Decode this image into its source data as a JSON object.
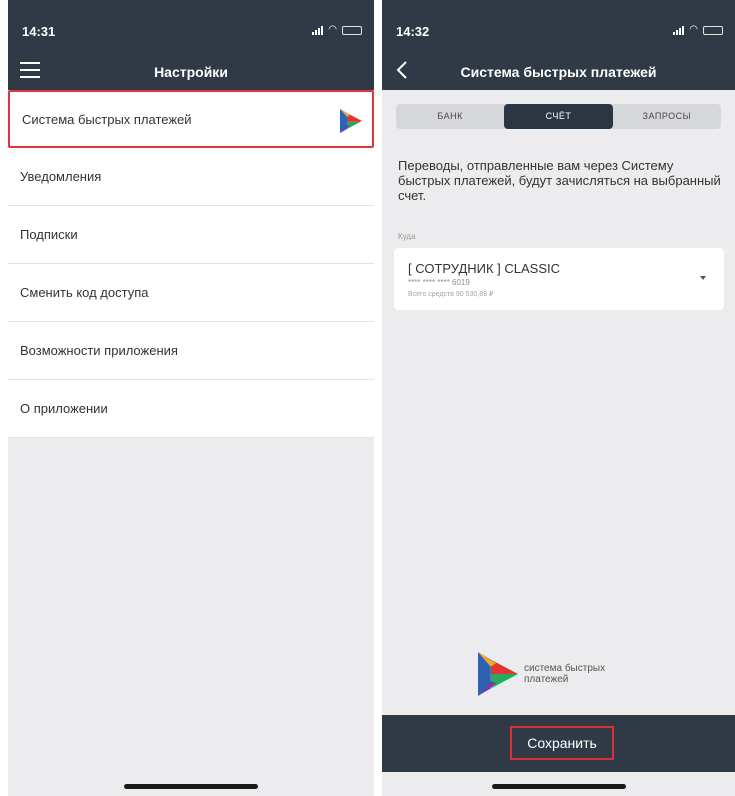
{
  "left_screen": {
    "status": {
      "time": "14:31"
    },
    "header": {
      "title": "Настройки"
    },
    "menu_items": [
      {
        "label": "Система быстрых платежей",
        "highlighted": true
      },
      {
        "label": "Уведомления"
      },
      {
        "label": "Подписки"
      },
      {
        "label": "Сменить код доступа"
      },
      {
        "label": "Возможности приложения"
      },
      {
        "label": "О приложении"
      }
    ]
  },
  "right_screen": {
    "status": {
      "time": "14:32"
    },
    "header": {
      "title": "Система быстрых платежей"
    },
    "tabs": [
      {
        "label": "БАНК",
        "active": false
      },
      {
        "label": "СЧЁТ",
        "active": true
      },
      {
        "label": "ЗАПРОСЫ",
        "active": false
      }
    ],
    "description": "Переводы, отправленные вам через Систему быстрых платежей, будут зачисляться на выбранный счет.",
    "field_label": "Куда",
    "account": {
      "name": "[ СОТРУДНИК ] CLASSIC",
      "number": "**** **** **** 6019",
      "balance": "Всего средств 90 530,89 ₽"
    },
    "brand_text": "система быстрых платежей",
    "save_label": "Сохранить"
  },
  "colors": {
    "header_bg": "#303a46",
    "highlight_border": "#e0343f",
    "screen_bg": "#ececee",
    "sbp_logo": [
      "#2d63b1",
      "#e5342f",
      "#f2a72b",
      "#29a960",
      "#7a3b98"
    ]
  },
  "icons": [
    "menu-icon",
    "back-icon",
    "sbp-logo-icon",
    "chevron-down-icon",
    "signal-icon",
    "wifi-icon",
    "battery-icon"
  ]
}
